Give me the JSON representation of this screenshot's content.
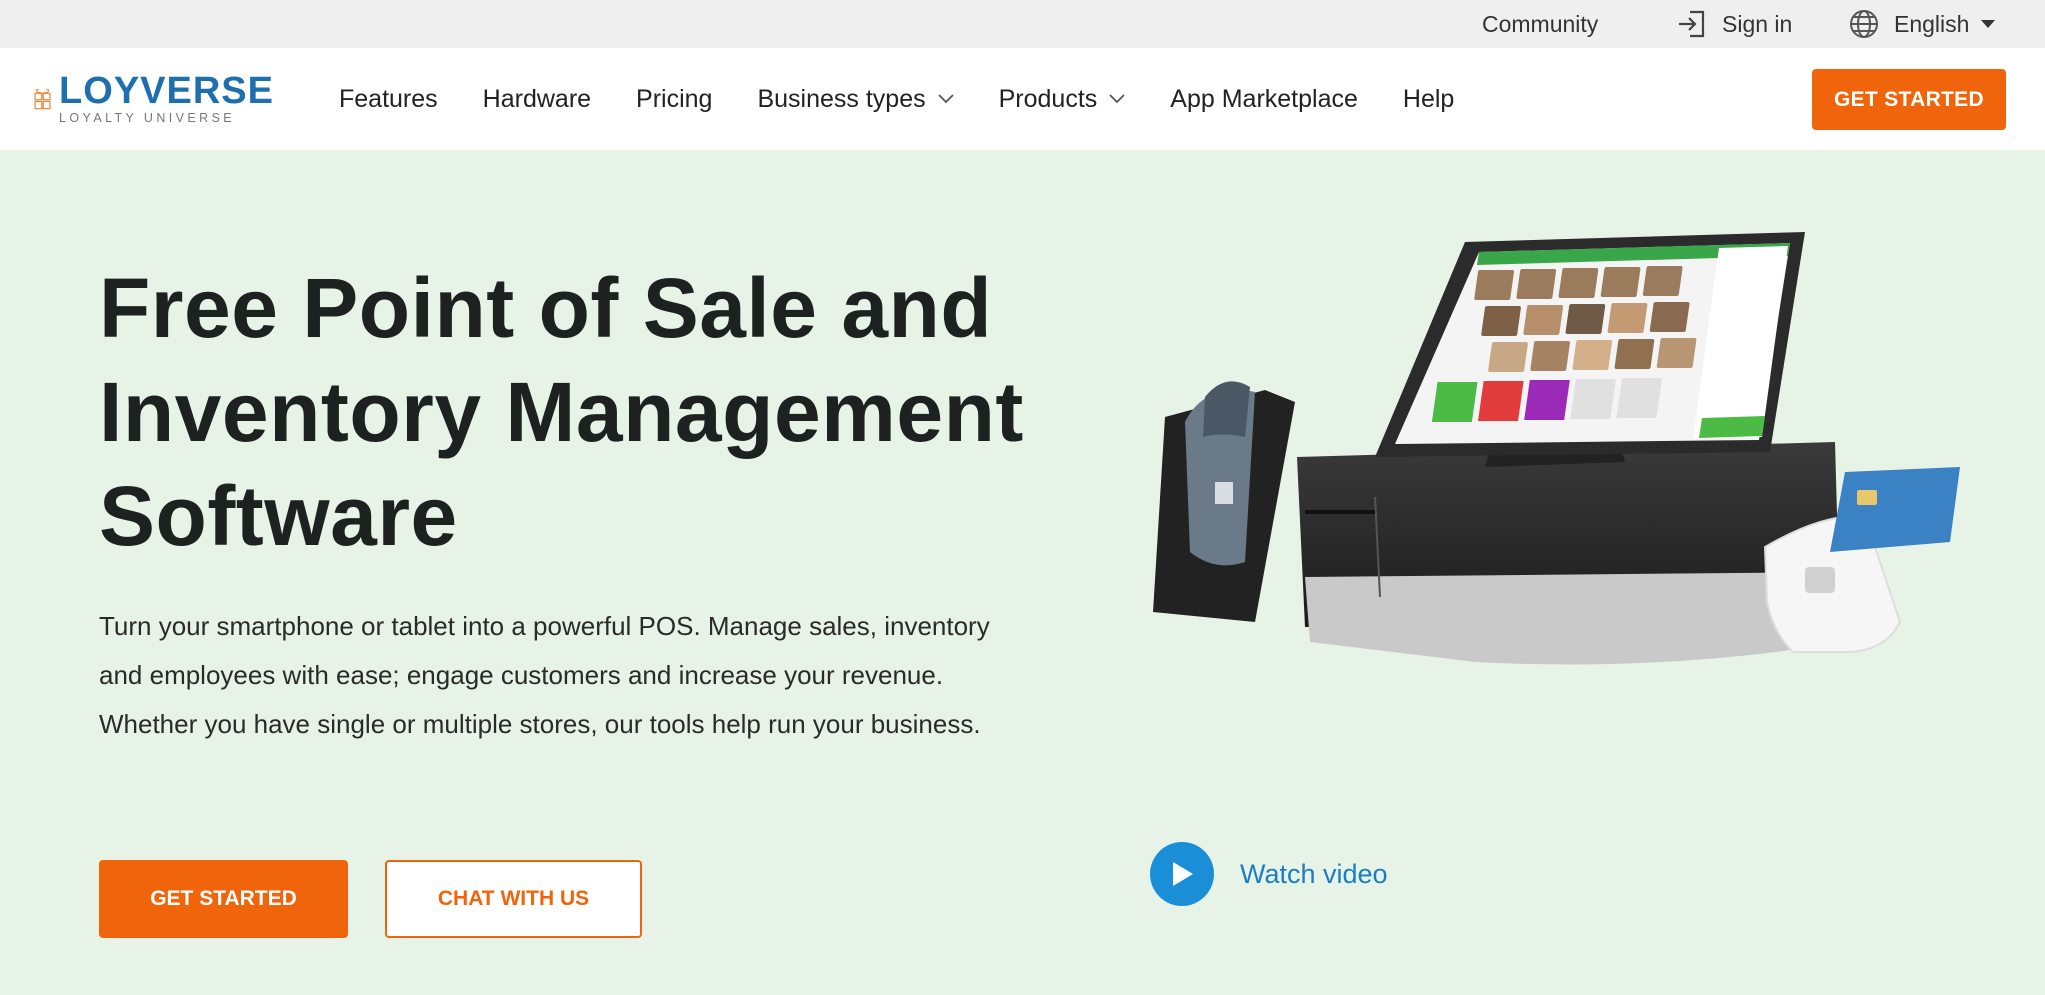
{
  "topbar": {
    "community": "Community",
    "sign_in": "Sign in",
    "language": "English"
  },
  "logo": {
    "name": "LOYVERSE",
    "tagline": "LOYALTY UNIVERSE"
  },
  "nav": {
    "items": [
      {
        "label": "Features"
      },
      {
        "label": "Hardware"
      },
      {
        "label": "Pricing"
      },
      {
        "label": "Business types",
        "dropdown": true
      },
      {
        "label": "Products",
        "dropdown": true
      },
      {
        "label": "App Marketplace"
      },
      {
        "label": "Help"
      }
    ],
    "cta": "GET STARTED"
  },
  "hero": {
    "title_lines": [
      "Free Point of Sale and",
      "Inventory Management",
      "Software"
    ],
    "description": "Turn your smartphone or tablet into a powerful POS. Manage sales, inventory and employees with ease; engage customers and increase your revenue. Whether you have single or multiple stores, our tools help run your business.",
    "primary_button": "GET STARTED",
    "secondary_button": "CHAT WITH US",
    "watch_video": "Watch video"
  },
  "colors": {
    "accent": "#f0650c",
    "brand_blue": "#1e6fb0",
    "hero_bg": "#e8f3e8",
    "link_blue": "#1a7dc4"
  }
}
